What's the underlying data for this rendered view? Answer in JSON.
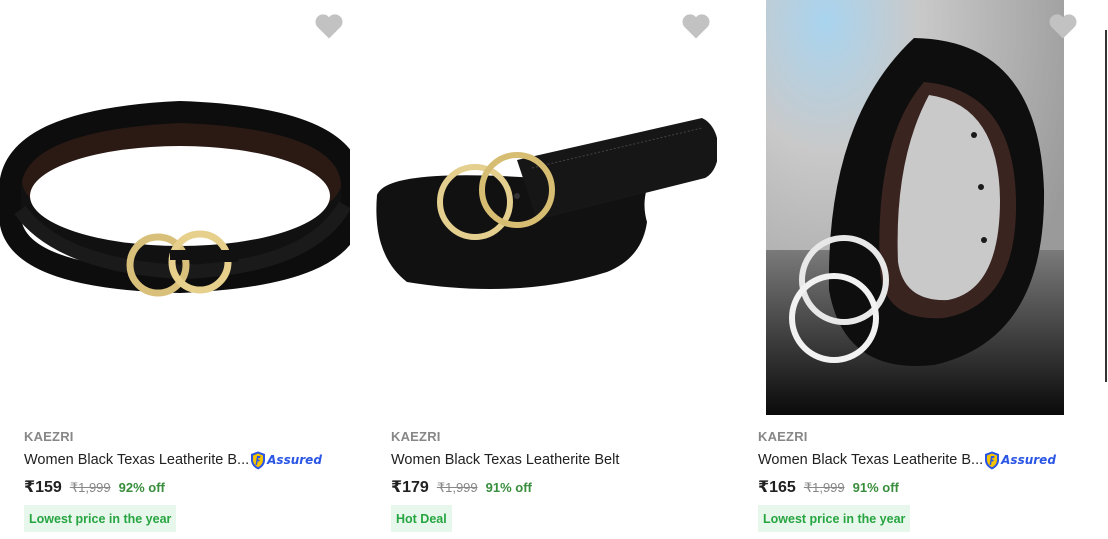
{
  "products": [
    {
      "brand": "KAEZRI",
      "title": "Women Black Texas Leatherite B...",
      "assured": true,
      "assured_label": "Assured",
      "price": "₹159",
      "mrp": "₹1,999",
      "discount": "92% off",
      "tag": "Lowest price in the year",
      "image": "black-belt-gold-gg-buckle",
      "wishlist_icon": "heart-icon"
    },
    {
      "brand": "KAEZRI",
      "title": "Women Black Texas Leatherite Belt",
      "assured": false,
      "price": "₹179",
      "mrp": "₹1,999",
      "discount": "91% off",
      "tag": "Hot Deal",
      "image": "black-belt-gold-double-ring-buckle",
      "wishlist_icon": "heart-icon"
    },
    {
      "brand": "KAEZRI",
      "title": "Women Black Texas Leatherite B...",
      "assured": true,
      "assured_label": "Assured",
      "price": "₹165",
      "mrp": "₹1,999",
      "discount": "91% off",
      "tag": "Lowest price in the year",
      "image": "black-belt-silver-double-ring-buckle",
      "wishlist_icon": "heart-icon"
    }
  ],
  "colors": {
    "price_text": "#212121",
    "muted_text": "#878787",
    "discount_green": "#388e3c",
    "tag_bg": "#e8f7ec",
    "tag_text": "#26a541",
    "assured_blue": "#2a55e5",
    "wishlist_heart": "#c2c2c2"
  }
}
